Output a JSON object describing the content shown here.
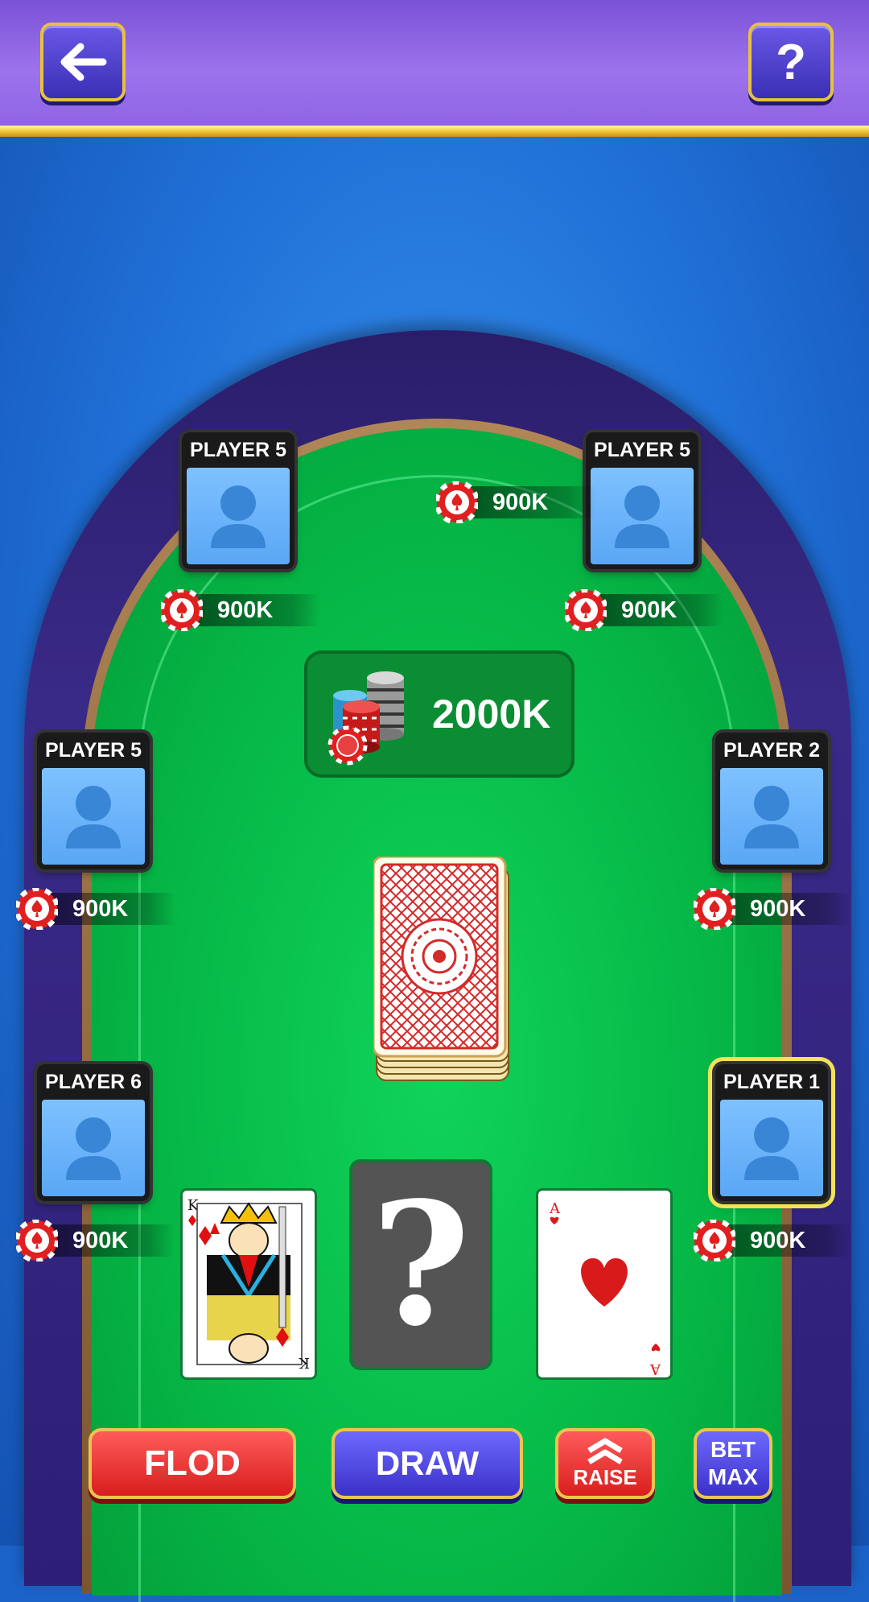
{
  "header": {
    "back_icon": "arrow-left-icon",
    "help_label": "?"
  },
  "players": [
    {
      "name": "PLAYER 5",
      "chips": "900K",
      "active": false
    },
    {
      "name": "PLAYER 5",
      "chips": "900K",
      "active": false
    },
    {
      "name": "PLAYER 5",
      "chips": "900K",
      "active": false
    },
    {
      "name": "PLAYER 2",
      "chips": "900K",
      "active": false
    },
    {
      "name": "PLAYER 6",
      "chips": "900K",
      "active": false
    },
    {
      "name": "PLAYER 1",
      "chips": "900K",
      "active": true
    }
  ],
  "dealer": {
    "chips": "900K"
  },
  "pot": {
    "amount": "2000K"
  },
  "hand": {
    "left_card": {
      "rank": "K",
      "suit": "diamond"
    },
    "middle_card": {
      "label": "?"
    },
    "right_card": {
      "rank": "A",
      "suit": "heart"
    }
  },
  "actions": {
    "flod": "FLOD",
    "draw": "DRAW",
    "raise": "RAISE",
    "bet_line1": "BET",
    "bet_line2": "MAX"
  },
  "colors": {
    "felt": "#06c04c",
    "header": "#8f63e4",
    "accent_gold": "#e9c550",
    "chip_red": "#e02020"
  }
}
